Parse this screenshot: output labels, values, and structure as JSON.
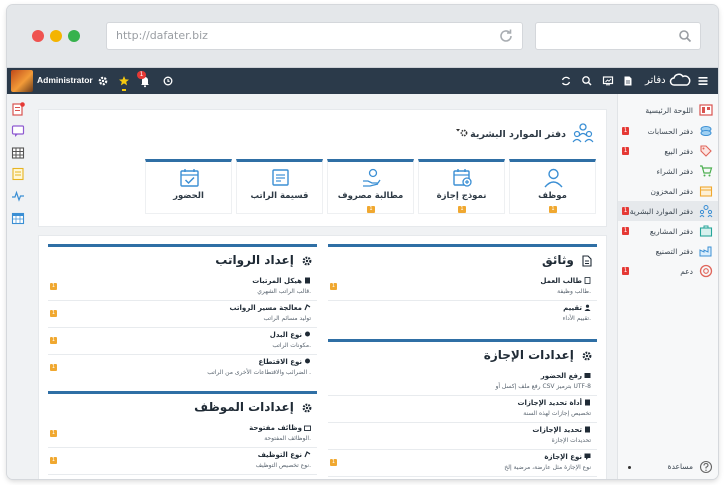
{
  "browser": {
    "url": "http://dafater.biz"
  },
  "topbar": {
    "user_name": "Administrator",
    "notification_count": "1",
    "brand_name": "دفاتر"
  },
  "page": {
    "title": "دفتر الموارد البشرية"
  },
  "cards": [
    {
      "label": "موظف",
      "badge": "1",
      "icon": "user-icon"
    },
    {
      "label": "نموذج إجازة",
      "badge": "1",
      "icon": "calendar-plus-icon"
    },
    {
      "label": "مطالبة مصروف",
      "badge": "1",
      "icon": "hand-coins-icon"
    },
    {
      "label": "قسيمة الراتب",
      "badge": "",
      "icon": "payslip-icon"
    },
    {
      "label": "الحضور",
      "badge": "",
      "icon": "calendar-check-icon"
    }
  ],
  "sections": {
    "documents": {
      "title": "وثائق",
      "items": [
        {
          "title": "طالب العمل",
          "desc": "طالب وظيفة.",
          "badge": "1"
        },
        {
          "title": "تقييم",
          "desc": "تقييم الأداء.",
          "badge": ""
        }
      ]
    },
    "leave_settings": {
      "title": "إعدادات الإجازة",
      "items": [
        {
          "title": "رفع الحضور",
          "desc": "رفع ملف إكسل أو CSV بترميز UTF-8",
          "badge": ""
        },
        {
          "title": "أداة تحديد الإجازات",
          "desc": "تخصيص إجازات لهذه السنة",
          "badge": ""
        },
        {
          "title": "تحديد الإجازات",
          "desc": "تحديدات الإجازة",
          "badge": ""
        },
        {
          "title": "نوع الإجازة",
          "desc": "نوع الإجازة مثل عارضة، مرضية إلخ",
          "badge": "1"
        }
      ]
    },
    "salary_setup": {
      "title": "إعداد الرواتب",
      "items": [
        {
          "title": "هيكل المرتبات",
          "desc": "قالب الراتب الشهري.",
          "badge": "1"
        },
        {
          "title": "معالجة مسير الرواتب",
          "desc": "توليد مسائم الراتب",
          "badge": "1"
        },
        {
          "title": "نوع البدل",
          "desc": "مكونات الراتب.",
          "badge": "1"
        },
        {
          "title": "نوع الاقتطاع",
          "desc": "الضرائب والاقتطاعات الأخرى من الراتب .",
          "badge": "1"
        }
      ]
    },
    "employee_setup": {
      "title": "إعدادات الموظف",
      "items": [
        {
          "title": "وظائف مفتوحة",
          "desc": "الوظائف المفتوحة.",
          "badge": "1"
        },
        {
          "title": "نوع التوظيف",
          "desc": "نوع تخصيص التوظيف.",
          "badge": "1"
        }
      ]
    }
  },
  "sidebar": {
    "items": [
      {
        "label": "اللوحة الرئيسية",
        "icon": "dashboard-icon",
        "badge": "",
        "color": "#d9534f"
      },
      {
        "label": "دفتر الحسابات",
        "icon": "accounts-icon",
        "badge": "1",
        "color": "#3b8fd4"
      },
      {
        "label": "دفتر البيع",
        "icon": "tag-icon",
        "badge": "1",
        "color": "#e0655a"
      },
      {
        "label": "دفتر الشراء",
        "icon": "cart-icon",
        "badge": "",
        "color": "#4caf50"
      },
      {
        "label": "دفتر المخزون",
        "icon": "box-icon",
        "badge": "",
        "color": "#f0a830"
      },
      {
        "label": "دفتر الموارد البشرية",
        "icon": "people-icon",
        "badge": "1",
        "color": "#3b8fd4"
      },
      {
        "label": "دفتر المشاريع",
        "icon": "briefcase-icon",
        "badge": "1",
        "color": "#26a69a"
      },
      {
        "label": "دفتر التصنيع",
        "icon": "factory-icon",
        "badge": "",
        "color": "#3b8fd4"
      },
      {
        "label": "دعم",
        "icon": "support-icon",
        "badge": "1",
        "color": "#e0655a"
      }
    ],
    "help_label": "مساعدة"
  },
  "colors": {
    "topbar": "#2b3a4a",
    "accent": "#2f6fa5",
    "badge_red": "#e53935",
    "badge_orange": "#f0a830"
  }
}
